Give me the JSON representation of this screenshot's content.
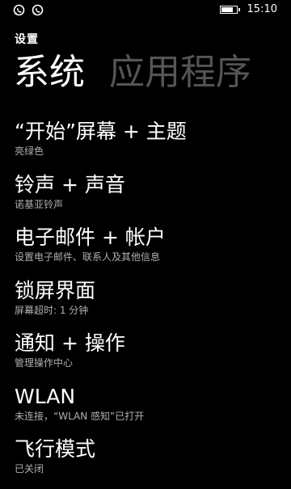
{
  "status_bar": {
    "notification_icons": [
      "whatsapp-icon",
      "whatsapp-icon"
    ],
    "battery_level": 0.8,
    "time": "15:10"
  },
  "header": {
    "app_title": "设置",
    "pivot_active": "系统",
    "pivot_next": "应用程序"
  },
  "settings": [
    {
      "title": "“开始”屏幕 + 主题",
      "subtitle": "亮绿色"
    },
    {
      "title": "铃声 + 声音",
      "subtitle": "诺基亚铃声"
    },
    {
      "title": "电子邮件 + 帐户",
      "subtitle": "设置电子邮件、联系人及其他信息"
    },
    {
      "title": "锁屏界面",
      "subtitle": "屏幕超时: 1 分钟"
    },
    {
      "title": "通知 + 操作",
      "subtitle": "管理操作中心"
    },
    {
      "title": "WLAN",
      "subtitle": "未连接，“WLAN 感知”已打开"
    },
    {
      "title": "飞行模式",
      "subtitle": "已关闭"
    }
  ],
  "colors": {
    "background": "#000000",
    "text": "#ffffff",
    "subtext": "#b0b0b0",
    "inactive_pivot": "#555555"
  }
}
